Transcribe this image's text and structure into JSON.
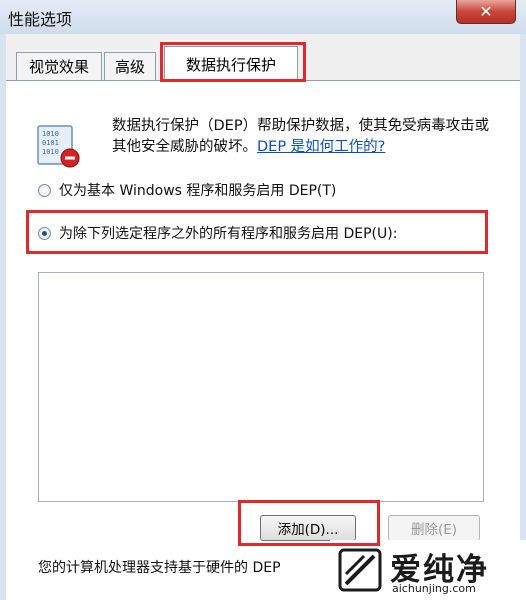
{
  "window": {
    "title": "性能选项",
    "close_label": "✕"
  },
  "tabs": [
    {
      "label": "视觉效果"
    },
    {
      "label": "高级"
    },
    {
      "label": "数据执行保护"
    }
  ],
  "dep": {
    "description": "数据执行保护（DEP）帮助保护数据，使其免受病毒攻击或其他安全威胁的破坏。",
    "link": "DEP 是如何工作的?",
    "icon": "dep-shield-binary-icon"
  },
  "options": {
    "essential_only": "仅为基本 Windows 程序和服务启用 DEP(T)",
    "all_except": "为除下列选定程序之外的所有程序和服务启用 DEP(U):",
    "selected": "all_except"
  },
  "buttons": {
    "add": "添加(D)...",
    "remove": "删除(E)"
  },
  "footer": {
    "text": "您的计算机处理器支持基于硬件的 DEP"
  },
  "watermark": {
    "name": "爱纯净",
    "url": "aichunjing.com"
  },
  "colors": {
    "highlight_box": "#e02a2a",
    "link": "#0b50c8",
    "titlebar": "#d7e4f2"
  }
}
